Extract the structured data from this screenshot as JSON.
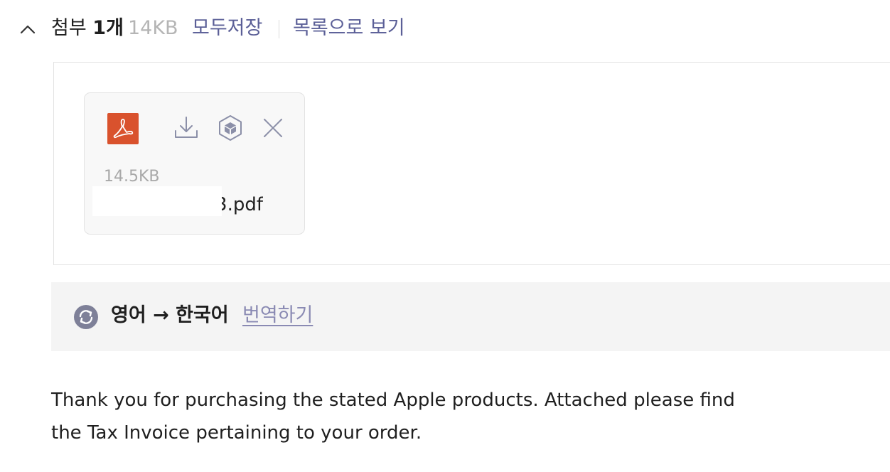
{
  "attachments_header": {
    "label": "첨부",
    "count": "1개",
    "total_size": "14KB",
    "save_all": "모두저장",
    "view_list": "목록으로 보기",
    "toggle_icon": "chevron-up-icon"
  },
  "file": {
    "type_icon": "pdf-icon",
    "size": "14.5KB",
    "name": "3.pdf",
    "actions": [
      "download-icon",
      "cube-icon",
      "close-icon"
    ]
  },
  "translation": {
    "icon": "translate-icon",
    "languages": "영어 → 한국어",
    "action": "번역하기"
  },
  "message": {
    "lines": [
      "Thank you for purchasing the stated Apple products. Attached please find",
      "the Tax Invoice pertaining to your order."
    ]
  },
  "colors": {
    "link": "#5b5f97",
    "pdf": "#d9522d",
    "icon_gray": "#8b8fa8"
  }
}
